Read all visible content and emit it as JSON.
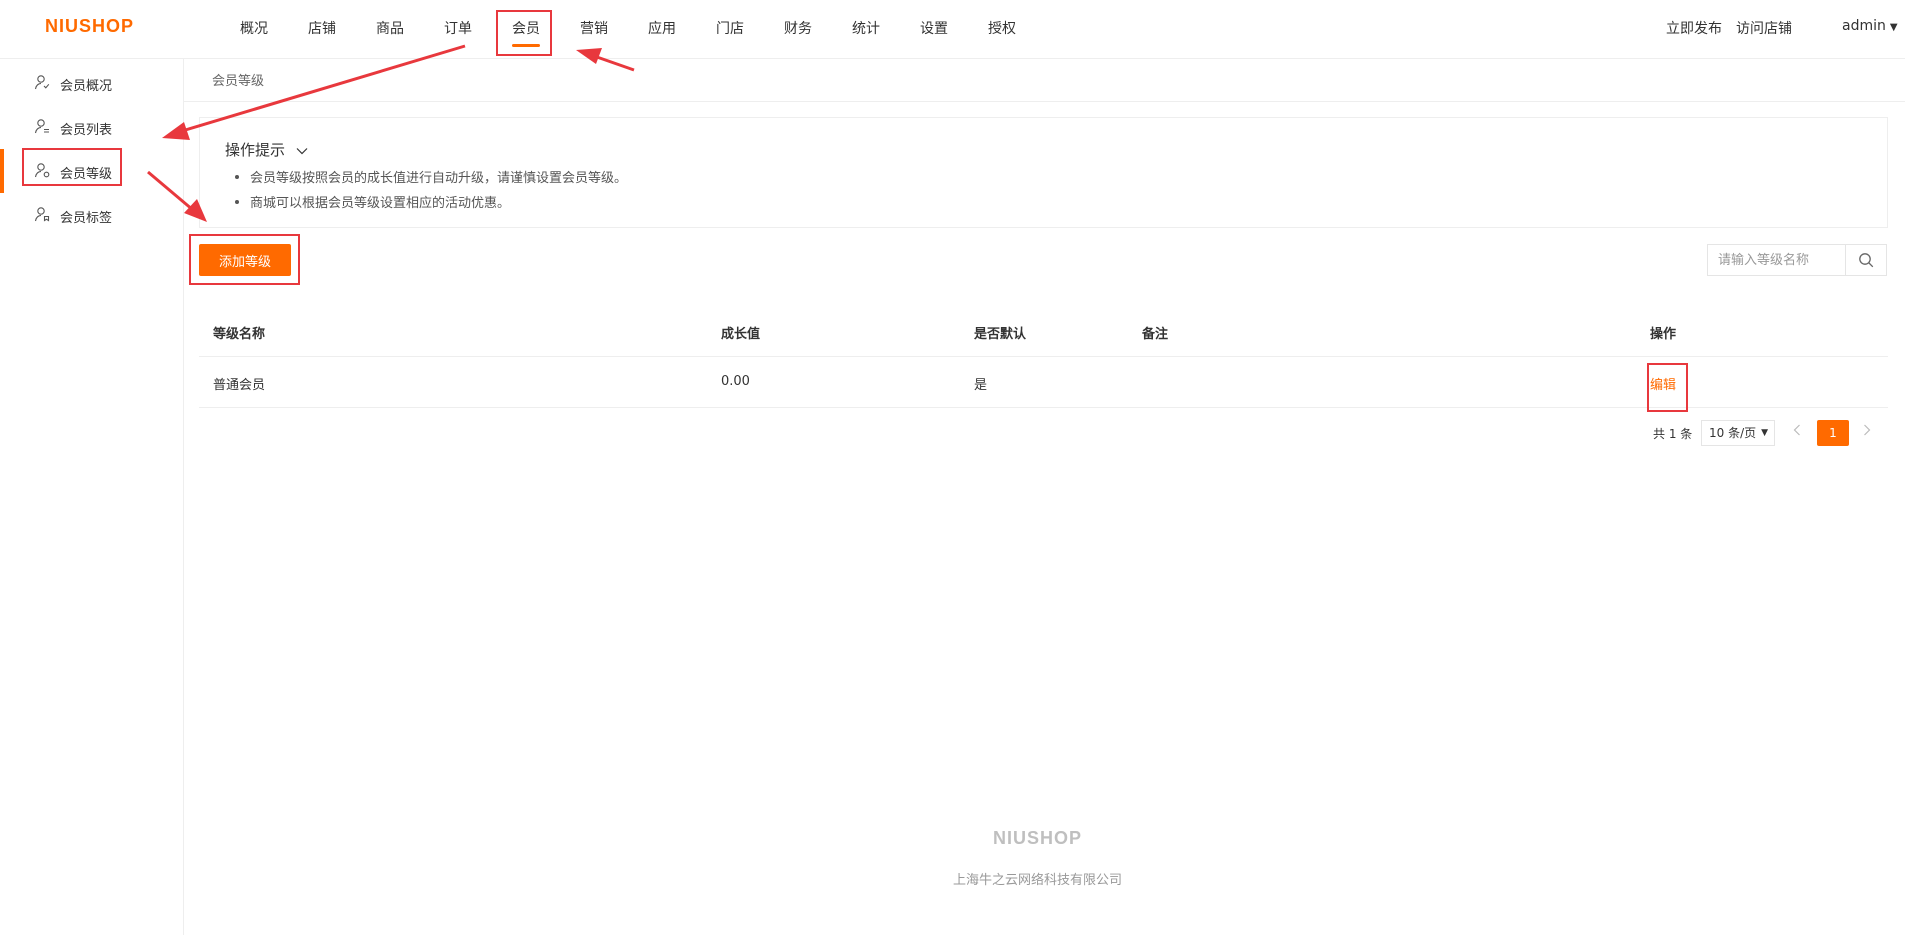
{
  "brand": {
    "logo": "NIUSHOP",
    "accent": "#ff6a00"
  },
  "nav": {
    "items": [
      {
        "label": "概况"
      },
      {
        "label": "店铺"
      },
      {
        "label": "商品"
      },
      {
        "label": "订单"
      },
      {
        "label": "会员",
        "active": true
      },
      {
        "label": "营销"
      },
      {
        "label": "应用"
      },
      {
        "label": "门店"
      },
      {
        "label": "财务"
      },
      {
        "label": "统计"
      },
      {
        "label": "设置"
      },
      {
        "label": "授权"
      }
    ],
    "publish": "立即发布",
    "visit_store": "访问店铺",
    "user": "admin"
  },
  "sidebar": {
    "items": [
      {
        "label": "会员概况",
        "icon": "user-overview-icon"
      },
      {
        "label": "会员列表",
        "icon": "user-list-icon"
      },
      {
        "label": "会员等级",
        "icon": "user-level-icon",
        "active": true
      },
      {
        "label": "会员标签",
        "icon": "user-tag-icon"
      }
    ]
  },
  "breadcrumb": "会员等级",
  "tips": {
    "title": "操作提示",
    "items": [
      "会员等级按照会员的成长值进行自动升级，请谨慎设置会员等级。",
      "商城可以根据会员等级设置相应的活动优惠。"
    ]
  },
  "toolbar": {
    "add_label": "添加等级",
    "search_placeholder": "请输入等级名称"
  },
  "table": {
    "headers": [
      "等级名称",
      "成长值",
      "是否默认",
      "备注",
      "操作"
    ],
    "rows": [
      {
        "name": "普通会员",
        "growth": "0.00",
        "default": "是",
        "remark": "",
        "action": "编辑"
      }
    ]
  },
  "pagination": {
    "total": "共 1 条",
    "page_size": "10 条/页",
    "current": "1"
  },
  "footer": {
    "logo": "NIUSHOP",
    "company": "上海牛之云网络科技有限公司"
  },
  "annotation_color": "#e8383d"
}
